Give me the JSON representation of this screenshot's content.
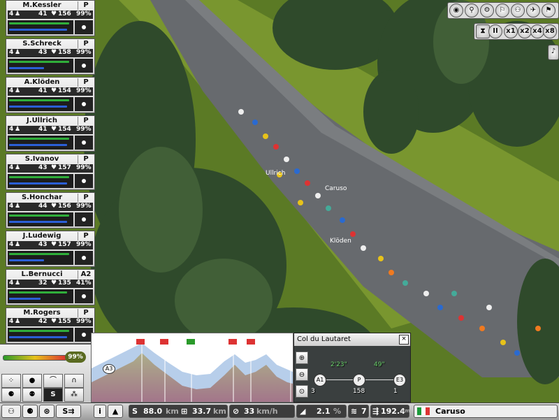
{
  "riders": [
    {
      "name": "M.Kessler",
      "role": "P",
      "num": "4",
      "a": "41",
      "b": "156",
      "pct": "99%",
      "g": 0.95,
      "b2": 0.92
    },
    {
      "name": "S.Schreck",
      "role": "P",
      "num": "4",
      "a": "43",
      "b": "158",
      "pct": "99%",
      "g": 0.95,
      "b2": 0.55
    },
    {
      "name": "A.Klöden",
      "role": "P",
      "num": "4",
      "a": "41",
      "b": "154",
      "pct": "99%",
      "g": 0.95,
      "b2": 0.92
    },
    {
      "name": "J.Ullrich",
      "role": "P",
      "num": "4",
      "a": "41",
      "b": "154",
      "pct": "99%",
      "g": 0.95,
      "b2": 0.92
    },
    {
      "name": "S.Ivanov",
      "role": "P",
      "num": "4",
      "a": "43",
      "b": "157",
      "pct": "99%",
      "g": 0.95,
      "b2": 0.92
    },
    {
      "name": "S.Honchar",
      "role": "P",
      "num": "4",
      "a": "44",
      "b": "156",
      "pct": "99%",
      "g": 0.95,
      "b2": 0.92
    },
    {
      "name": "J.Ludewig",
      "role": "P",
      "num": "4",
      "a": "43",
      "b": "157",
      "pct": "99%",
      "g": 0.95,
      "b2": 0.55
    },
    {
      "name": "L.Bernucci",
      "role": "A2",
      "num": "4",
      "a": "32",
      "b": "135",
      "pct": "41%",
      "g": 0.92,
      "b2": 0.5
    },
    {
      "name": "M.Rogers",
      "role": "P",
      "num": "4",
      "a": "42",
      "b": "155",
      "pct": "99%",
      "g": 0.95,
      "b2": 0.92
    }
  ],
  "toolbar": {
    "speeds": [
      "x1",
      "x2",
      "x4",
      "x8"
    ],
    "pause": "II",
    "music": "♪"
  },
  "map_labels": [
    {
      "text": "Ullrich"
    },
    {
      "text": "Caruso"
    },
    {
      "text": "Klöden"
    }
  ],
  "team_energy": "99%",
  "profile": {
    "start_marker": "A3"
  },
  "climb": {
    "title": "Col du Lautaret",
    "close": "×",
    "gap_left": "2'23\"",
    "gap_right": "49\"",
    "node_left": "A1",
    "node_mid": "P",
    "node_right": "E3",
    "count_left": "3",
    "count_mid": "158",
    "count_right": "1"
  },
  "status": {
    "info": "i",
    "distance_done": "88.0",
    "distance_unit": "km",
    "distance_left": "33.7",
    "distance_left_unit": "km",
    "speed": "33",
    "speed_unit": "km/h",
    "gradient": "2.1",
    "gradient_unit": "%",
    "wind": "7",
    "total": "192.4",
    "total_unit": "km",
    "leader": "Caruso"
  }
}
